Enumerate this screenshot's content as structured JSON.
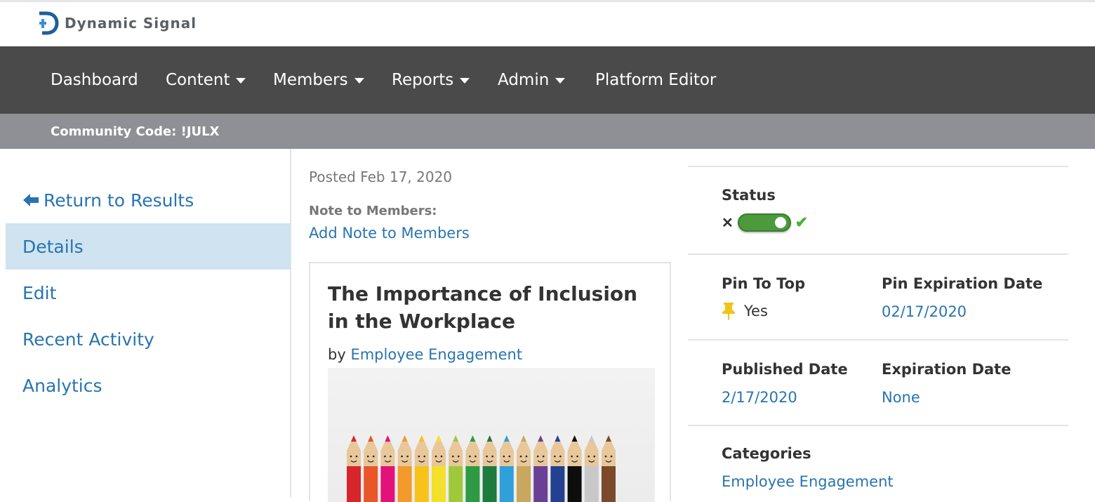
{
  "brand": {
    "name": "Dynamic Signal",
    "icon": "dynamic-signal-logo",
    "accent": "#2874b0"
  },
  "nav": {
    "items": [
      {
        "label": "Dashboard",
        "dropdown": false
      },
      {
        "label": "Content",
        "dropdown": true
      },
      {
        "label": "Members",
        "dropdown": true
      },
      {
        "label": "Reports",
        "dropdown": true
      },
      {
        "label": "Admin",
        "dropdown": true
      },
      {
        "label": "Platform Editor",
        "dropdown": false
      }
    ]
  },
  "community": {
    "text": "Community Code: !JULX"
  },
  "sidebar": {
    "return_label": "Return to Results",
    "items": [
      {
        "label": "Details",
        "active": true
      },
      {
        "label": "Edit",
        "active": false
      },
      {
        "label": "Recent Activity",
        "active": false
      },
      {
        "label": "Analytics",
        "active": false
      }
    ]
  },
  "post": {
    "posted": "Posted Feb 17, 2020",
    "note_label": "Note to Members:",
    "note_link": "Add Note to Members",
    "title": "The Importance of Inclusion in the Workplace",
    "by_prefix": "by",
    "author": "Employee Engagement",
    "image": "colored-pencils-smiley-faces"
  },
  "details": {
    "status_label": "Status",
    "status_on": true,
    "pin_label": "Pin To Top",
    "pin_value": "Yes",
    "pin_expiration_label": "Pin Expiration Date",
    "pin_expiration_value": "02/17/2020",
    "published_label": "Published Date",
    "published_value": "2/17/2020",
    "expiration_label": "Expiration Date",
    "expiration_value": "None",
    "categories_label": "Categories",
    "categories_value": "Employee Engagement"
  },
  "colors": {
    "nav_bg": "#4a4a4a",
    "subbar_bg": "#8e9095",
    "active_bg": "#cfe3f0",
    "toggle_on": "#4c9a3c",
    "link": "#2874b0",
    "pin": "#f0c419"
  }
}
